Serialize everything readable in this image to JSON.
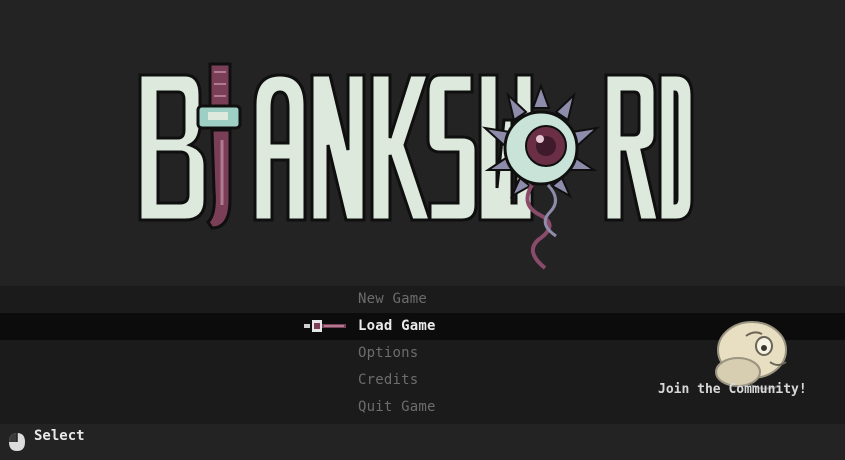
{
  "game": {
    "title": "BLANKSWORD"
  },
  "menu": {
    "items": [
      {
        "label": "New Game",
        "selected": false
      },
      {
        "label": "Load Game",
        "selected": true
      },
      {
        "label": "Options",
        "selected": false
      },
      {
        "label": "Credits",
        "selected": false
      },
      {
        "label": "Quit Game",
        "selected": false
      }
    ]
  },
  "community": {
    "label": "Join the Community!"
  },
  "controls": {
    "select_label": "Select",
    "select_icon": "mouse-left-click-icon"
  },
  "colors": {
    "background": "#232323",
    "menu_band": "#1b1b1b",
    "highlight": "#0c0c0c",
    "logo_letter": "#dde9dc",
    "logo_outline": "#0f0f0f",
    "sword_handle": "#7a3f57",
    "eye_petals": "#8e8cab",
    "iris": "#6a2f45"
  }
}
